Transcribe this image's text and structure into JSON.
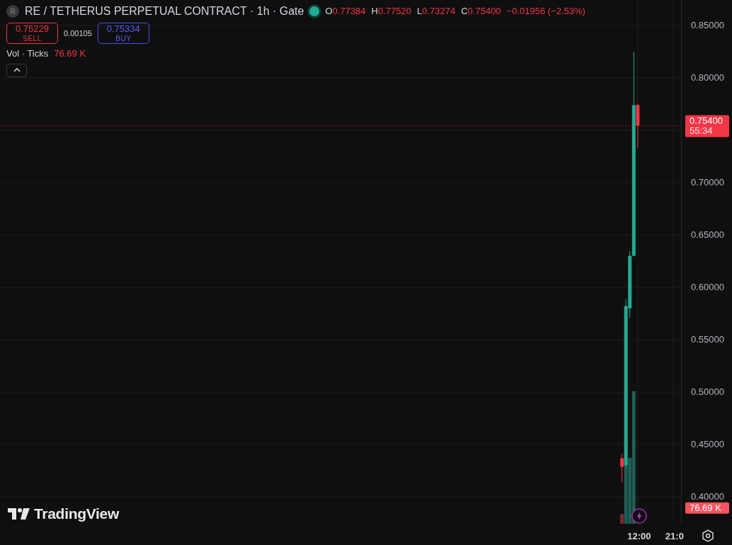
{
  "header": {
    "symbol_letter": "R",
    "title": "RE / TETHERUS PERPETUAL CONTRACT · 1h · Gate",
    "market_open": true,
    "ohlc": [
      {
        "label": "O",
        "value": "0.77384"
      },
      {
        "label": "H",
        "value": "0.77520"
      },
      {
        "label": "L",
        "value": "0.73274"
      },
      {
        "label": "C",
        "value": "0.75400"
      }
    ],
    "change": "−0.01956 (−2.53%)"
  },
  "trade": {
    "sell": {
      "price": "0.75229",
      "label": "SELL"
    },
    "spread": "0.00105",
    "buy": {
      "price": "0.75334",
      "label": "BUY"
    }
  },
  "volume_legend": {
    "label": "Vol · Ticks",
    "value": "76.69 K"
  },
  "price_axis": {
    "ticks": [
      "0.85000",
      "0.80000",
      "0.70000",
      "0.65000",
      "0.60000",
      "0.55000",
      "0.50000",
      "0.45000",
      "0.40000"
    ],
    "last_price": "0.75400",
    "countdown": "55:34",
    "volume_value": "76.69 K"
  },
  "time_axis": {
    "labels": [
      "12:00",
      "21:0"
    ]
  },
  "logo": {
    "text": "TradingView"
  }
}
